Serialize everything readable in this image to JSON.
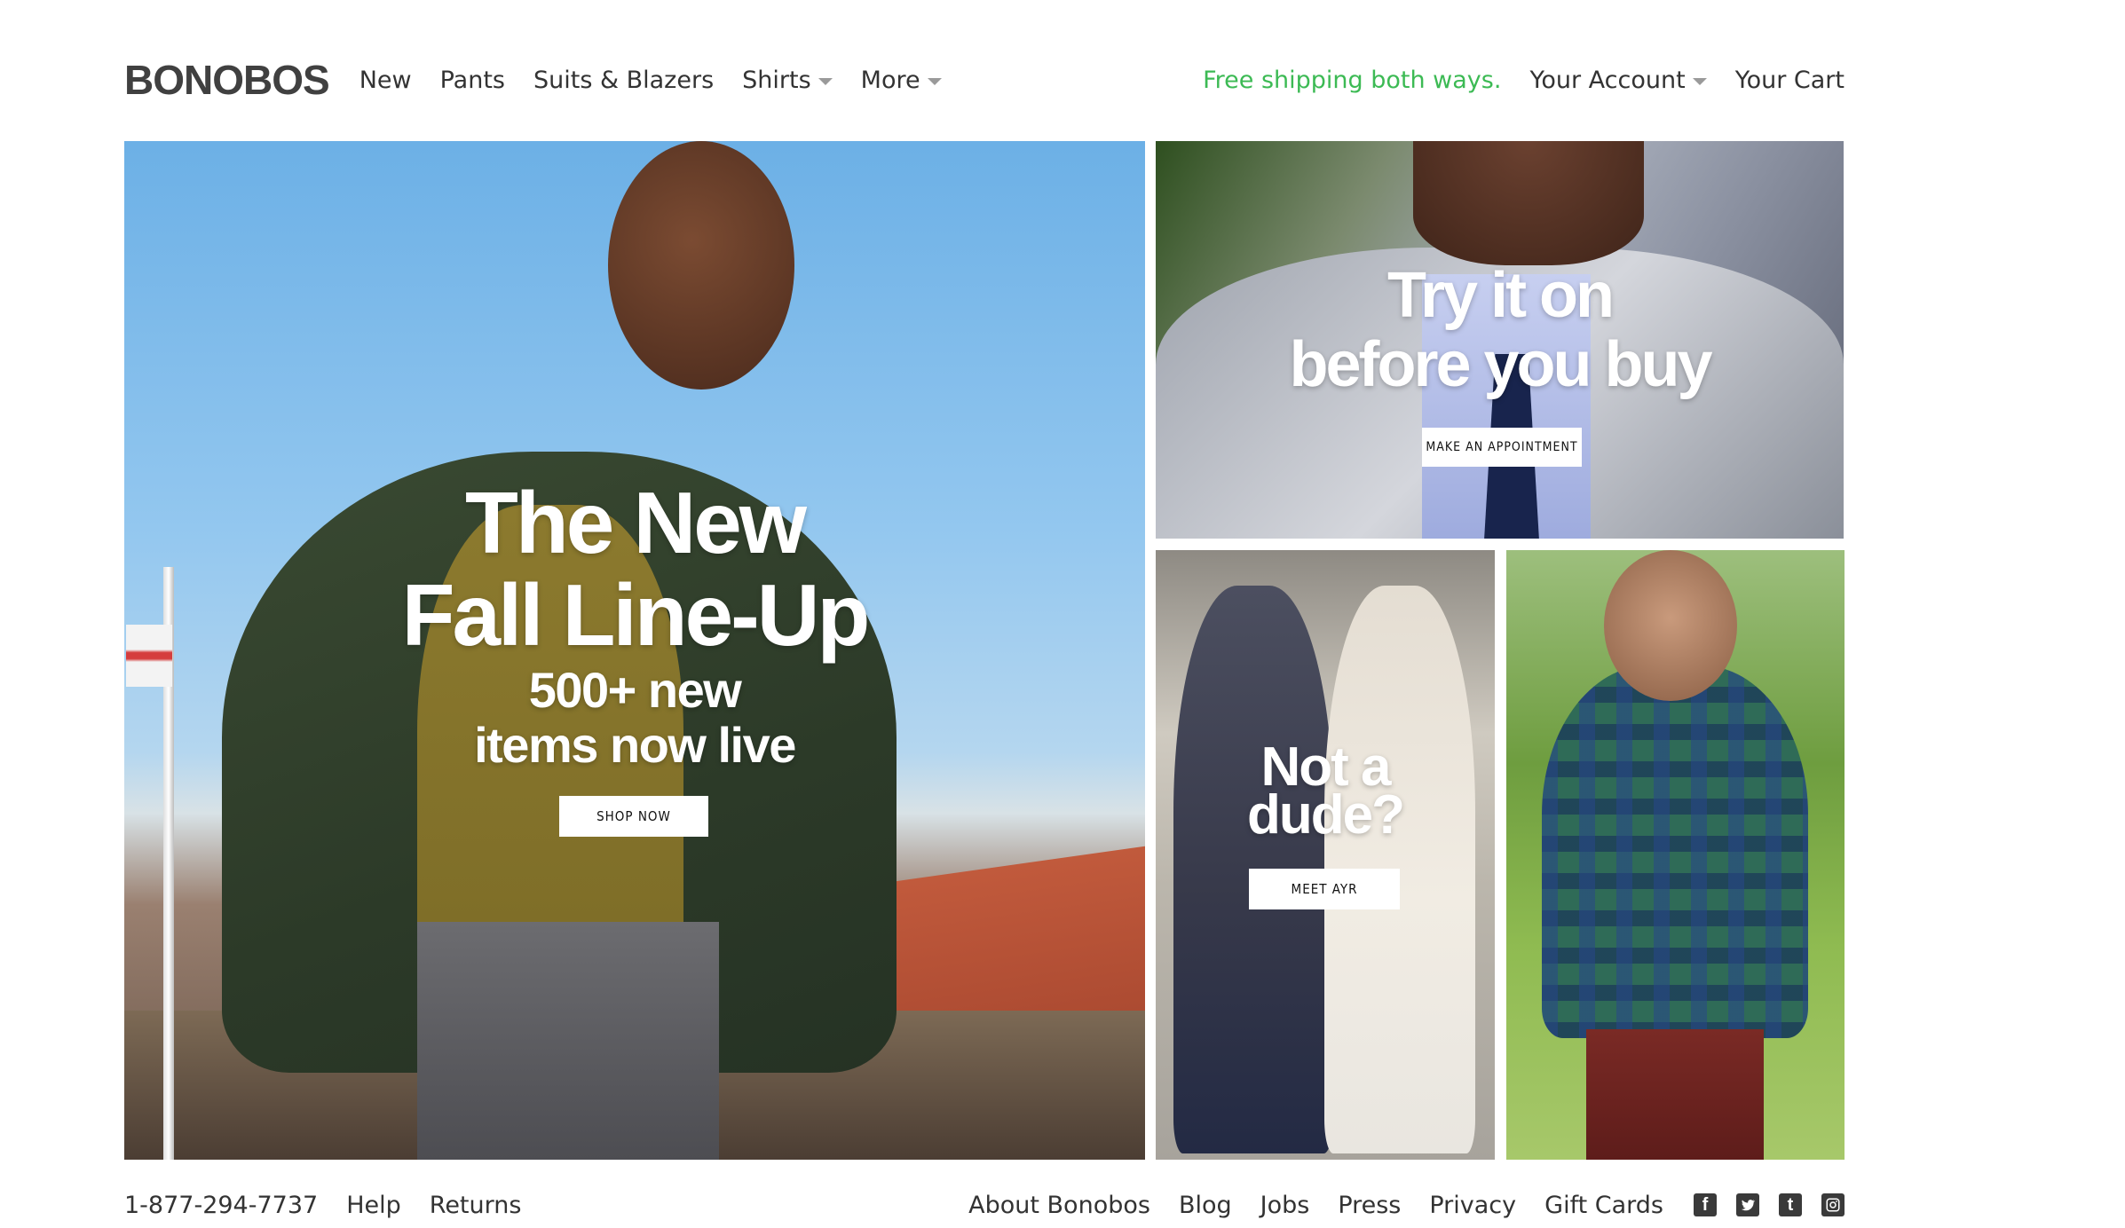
{
  "brand": {
    "logo": "BONOBOS"
  },
  "nav": {
    "items": [
      {
        "label": "New",
        "has_dropdown": false
      },
      {
        "label": "Pants",
        "has_dropdown": false
      },
      {
        "label": "Suits & Blazers",
        "has_dropdown": false
      },
      {
        "label": "Shirts",
        "has_dropdown": true
      },
      {
        "label": "More",
        "has_dropdown": true
      }
    ]
  },
  "header_right": {
    "promo": "Free shipping both ways.",
    "account": "Your Account",
    "cart": "Your Cart"
  },
  "hero": {
    "title_line1": "The New",
    "title_line2": "Fall Line-Up",
    "subtitle_line1": "500+ new",
    "subtitle_line2": "items now live",
    "cta": "SHOP NOW"
  },
  "tile_suit": {
    "title_line1": "Try it on",
    "title_line2": "before you buy",
    "cta": "MAKE AN APPOINTMENT"
  },
  "tile_ayr": {
    "title_line1": "Not a",
    "title_line2": "dude?",
    "cta": "MEET AYR"
  },
  "footer": {
    "left": {
      "phone": "1-877-294-7737",
      "help": "Help",
      "returns": "Returns"
    },
    "right": {
      "about": "About Bonobos",
      "blog": "Blog",
      "jobs": "Jobs",
      "press": "Press",
      "privacy": "Privacy",
      "gift_cards": "Gift Cards"
    },
    "social": [
      "facebook-icon",
      "twitter-icon",
      "tumblr-icon",
      "instagram-icon"
    ]
  },
  "colors": {
    "promo_green": "#3cba54",
    "text": "#333333",
    "caret": "#9a9a9a"
  }
}
